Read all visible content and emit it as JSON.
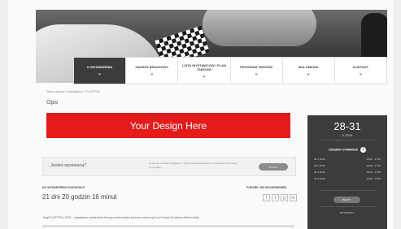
{
  "nav": {
    "items": [
      {
        "label": "O WYDARZENIU",
        "active": true
      },
      {
        "label": "ZAKRES BRANŻOWY",
        "active": false
      },
      {
        "label": "LISTA WYSTAWCÓW I PLAN TARGÓW",
        "active": false
      },
      {
        "label": "PROGRAM TARGÓW",
        "active": false
      },
      {
        "label": "MULTIMEDIA",
        "active": false
      },
      {
        "label": "KONTAKT",
        "active": false
      }
    ]
  },
  "breadcrumb": "Strona główna › Kalendarium › PLASTPOL",
  "section_title": "Opis",
  "banner": {
    "text": "Your Design Here",
    "color": "#e31b1b"
  },
  "exhibitor": {
    "question": "Jesteś wystawcą?",
    "info": "Dotąd się nie Dość Wystawcy z Wolną Czasową sprawdź w programie informacje o sposobie...",
    "button": "WYŚLIJ"
  },
  "countdown": {
    "label": "DO WYDARZENIA POZOSTAŁO",
    "value": "21 dni  20 godzin  16 minut"
  },
  "share": {
    "label": "PODZIEL SIĘ WYDARZENIEM",
    "icons": [
      "f",
      "t",
      "g",
      "✉"
    ]
  },
  "lead_text": "Targi PLASTPOL 2019 – największe wydarzenie branży przetwórstwa tworzyw sztucznych w Europie Środkowo-Wschodniej",
  "sidebar": {
    "dates": "28-31",
    "month_year": "V 2019",
    "hours_title": "GODZINY OTWARCIA",
    "rows": [
      {
        "date": "28 V 2019",
        "time": "10:00 - 17:00"
      },
      {
        "date": "29 V 2019",
        "time": "10:00 - 17:00"
      },
      {
        "date": "30 V 2019",
        "time": "10:00 - 17:00"
      },
      {
        "date": "31 V 2019",
        "time": "10:00 - 16:00"
      }
    ],
    "button_primary": "BILETY",
    "button_secondary": "WYSTAWCY"
  }
}
